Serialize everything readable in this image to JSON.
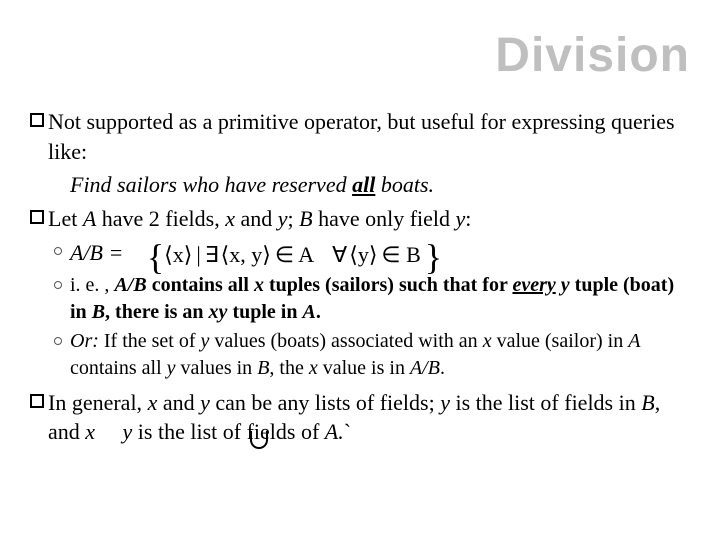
{
  "title": "Division",
  "p1_a": "Not supported as a primitive operator, but useful for expressing queries like:",
  "p1_example": "Find sailors who have reserved ",
  "p1_all": "all",
  "p1_example2": " boats.",
  "p2_a": "Let ",
  "p2_A": "A",
  "p2_b": " have 2 fields, ",
  "p2_x": "x",
  "p2_c": " and ",
  "p2_y": "y",
  "p2_d": "; ",
  "p2_B": "B",
  "p2_e": " have only field ",
  "p2_y2": "y",
  "p2_f": ":",
  "sub1_label": "A/B =",
  "set_expr_parts": {
    "lbrace": "{",
    "rbrace": "}",
    "langle": "⟨",
    "rangle": "⟩",
    "x": "x",
    "xy": "x, y",
    "y": "y",
    "bar": "|",
    "exists": "∃",
    "forall": "∀",
    "inA": "∈ A",
    "inB": "∈ B"
  },
  "sub2_a": "i. e. , ",
  "sub2_b": "A/B",
  "sub2_c": " contains all ",
  "sub2_d": "x",
  "sub2_e": " tuples (sailors) such that for ",
  "sub2_every": "every",
  "sub2_f": " ",
  "sub2_y": "y",
  "sub2_g": " tuple (boat) in ",
  "sub2_B": "B",
  "sub2_h": ", there is an ",
  "sub2_xy": "xy",
  "sub2_i": " tuple in ",
  "sub2_A": "A",
  "sub2_j": ".",
  "sub3_or": "Or:",
  "sub3_a": " If the set of ",
  "sub3_y": "y",
  "sub3_b": " values (boats) associated with an ",
  "sub3_x": "x",
  "sub3_c": " value (sailor) in ",
  "sub3_A": "A",
  "sub3_d": " contains all ",
  "sub3_y2": "y",
  "sub3_e": " values in ",
  "sub3_B": "B",
  "sub3_f": ", the ",
  "sub3_x2": "x",
  "sub3_g": " value is in ",
  "sub3_AB": "A/B",
  "sub3_h": ".",
  "p3_a": "In general, ",
  "p3_x": "x",
  "p3_b": " and ",
  "p3_y": "y",
  "p3_c": " can be any lists of fields; ",
  "p3_y2": "y",
  "p3_d": " is the list of fields in ",
  "p3_B": "B",
  "p3_e": ", and ",
  "p3_x2": "x",
  "p3_f": " ",
  "p3_y3": "y",
  "p3_g": " is the list of fields of ",
  "p3_A": "A.",
  "p3_tick": "`"
}
